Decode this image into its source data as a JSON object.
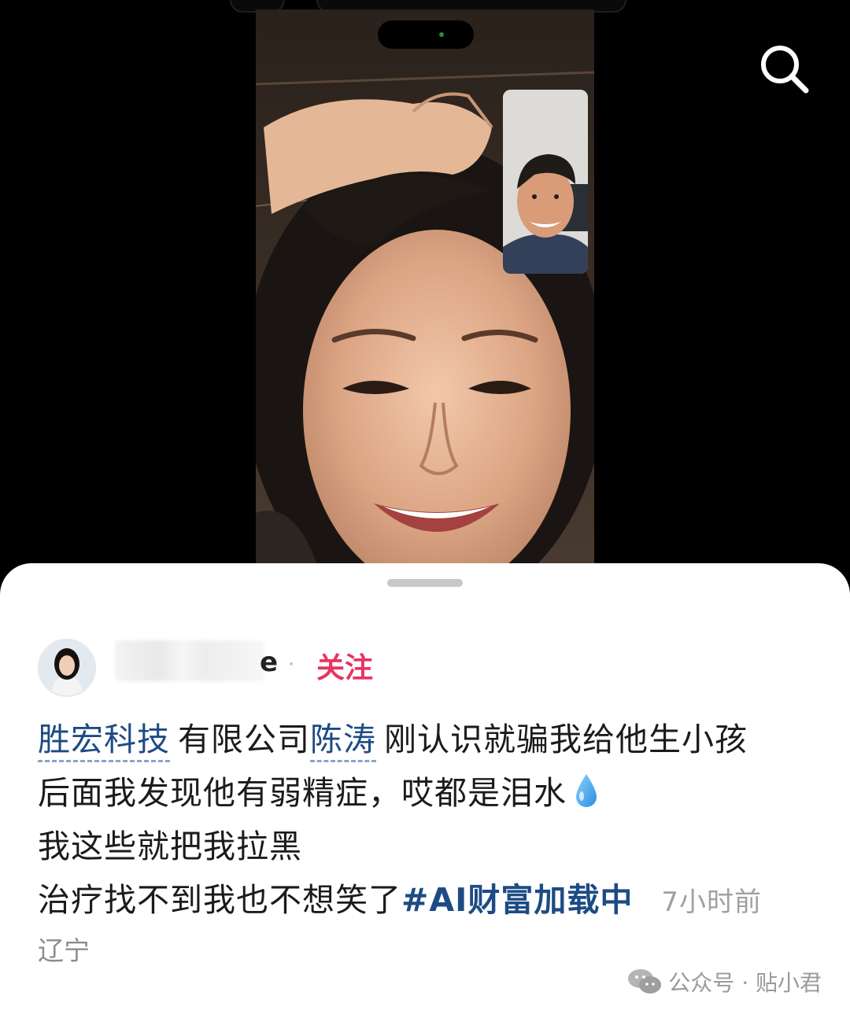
{
  "media": {
    "icons": {
      "search": "search-icon",
      "camera_dot": "camera-indicator-icon"
    }
  },
  "author": {
    "name_visible_tail": "e",
    "separator": "·",
    "follow_label": "关注"
  },
  "post": {
    "line1": {
      "tag1": "胜宏科技",
      "text1": "有限公司",
      "tag2": "陈涛",
      "text2": "刚认识就骗我给他生小孩"
    },
    "line2": {
      "text": "后面我发现他有弱精症，哎都是泪水",
      "emoji": "droplet-icon"
    },
    "line3": {
      "text": "我这些就把我拉黑"
    },
    "line4": {
      "text": "治疗找不到我也不想笑了",
      "hashtag": "#AI财富加载中",
      "time": "7小时前"
    },
    "location": "辽宁"
  },
  "watermark": {
    "icon": "wechat-icon",
    "text": "公众号 · 贴小君"
  },
  "colors": {
    "follow": "#e8345f",
    "link": "#1d4b85",
    "meta": "#a0a0a0"
  }
}
